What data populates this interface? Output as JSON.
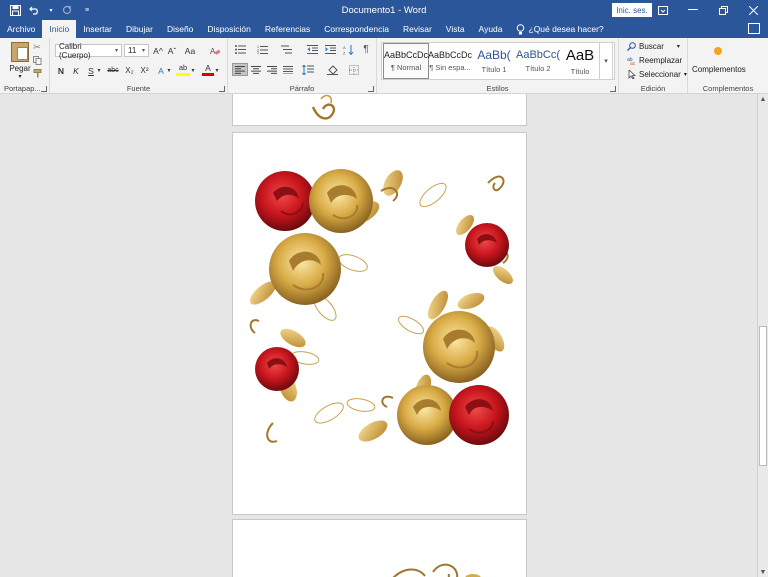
{
  "app": {
    "title": "Documento1 - Word",
    "signin_label": "Inic. ses."
  },
  "quick_access": {
    "icons": [
      "save-icon",
      "undo-icon",
      "redo-icon",
      "customize-icon"
    ]
  },
  "tabs": [
    {
      "label": "Archivo"
    },
    {
      "label": "Inicio"
    },
    {
      "label": "Insertar"
    },
    {
      "label": "Dibujar"
    },
    {
      "label": "Diseño"
    },
    {
      "label": "Disposición"
    },
    {
      "label": "Referencias"
    },
    {
      "label": "Correspondencia"
    },
    {
      "label": "Revisar"
    },
    {
      "label": "Vista"
    },
    {
      "label": "Ayuda"
    }
  ],
  "tellme": {
    "label": "¿Qué desea hacer?"
  },
  "ribbon": {
    "clipboard": {
      "paste_label": "Pegar",
      "group_label": "Portapap..."
    },
    "font": {
      "font_name": "Calibri (Cuerpo)",
      "font_size": "11",
      "bold": "N",
      "italic": "K",
      "underline": "S",
      "strike": "abc",
      "subscript": "X₂",
      "superscript": "X²",
      "grow": "A^",
      "shrink": "Aˇ",
      "case": "Aa",
      "effects": "A",
      "highlight": "ab",
      "color": "A",
      "group_label": "Fuente"
    },
    "paragraph": {
      "pilcrow": "¶",
      "group_label": "Párrafo"
    },
    "styles": {
      "items": [
        {
          "sample": "AaBbCcDc",
          "name": "¶ Normal"
        },
        {
          "sample": "AaBbCcDc",
          "name": "¶ Sin espa..."
        },
        {
          "sample": "AaBb(",
          "name": "Título 1"
        },
        {
          "sample": "AaBbCc(",
          "name": "Título 2"
        },
        {
          "sample": "AaB",
          "name": "Título"
        }
      ],
      "group_label": "Estilos"
    },
    "editing": {
      "find_label": "Buscar",
      "replace_label": "Reemplazar",
      "select_label": "Seleccionar",
      "group_label": "Edición"
    },
    "addins": {
      "label": "Complementos",
      "group_label": "Complementos"
    }
  },
  "colors": {
    "accent": "#2b579a",
    "rose_red": "#c8161d",
    "rose_gold": "#d9ab45"
  }
}
